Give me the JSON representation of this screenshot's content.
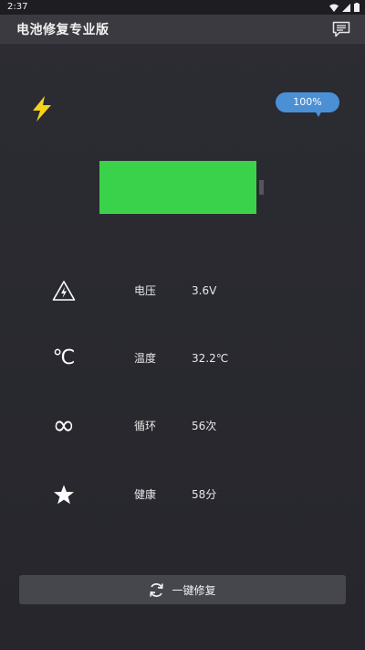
{
  "status_bar": {
    "time": "2:37"
  },
  "app": {
    "title": "电池修复专业版"
  },
  "battery": {
    "percent_label": "100%",
    "level": 1.0,
    "fill_color": "#3bd24b"
  },
  "stats": [
    {
      "icon": "warning-triangle-icon",
      "label": "电压",
      "value": "3.6V"
    },
    {
      "icon": "celsius-icon",
      "label": "温度",
      "value": "32.2℃"
    },
    {
      "icon": "infinity-icon",
      "label": "循环",
      "value": "56次"
    },
    {
      "icon": "star-icon",
      "label": "健康",
      "value": "58分"
    }
  ],
  "repair_button": {
    "label": "一键修复"
  },
  "glyphs": {
    "celsius": "℃",
    "infinity": "∞"
  },
  "colors": {
    "accent_blue": "#4b8fd5",
    "bolt_yellow": "#f5d21c",
    "background": "#2b2b31"
  }
}
